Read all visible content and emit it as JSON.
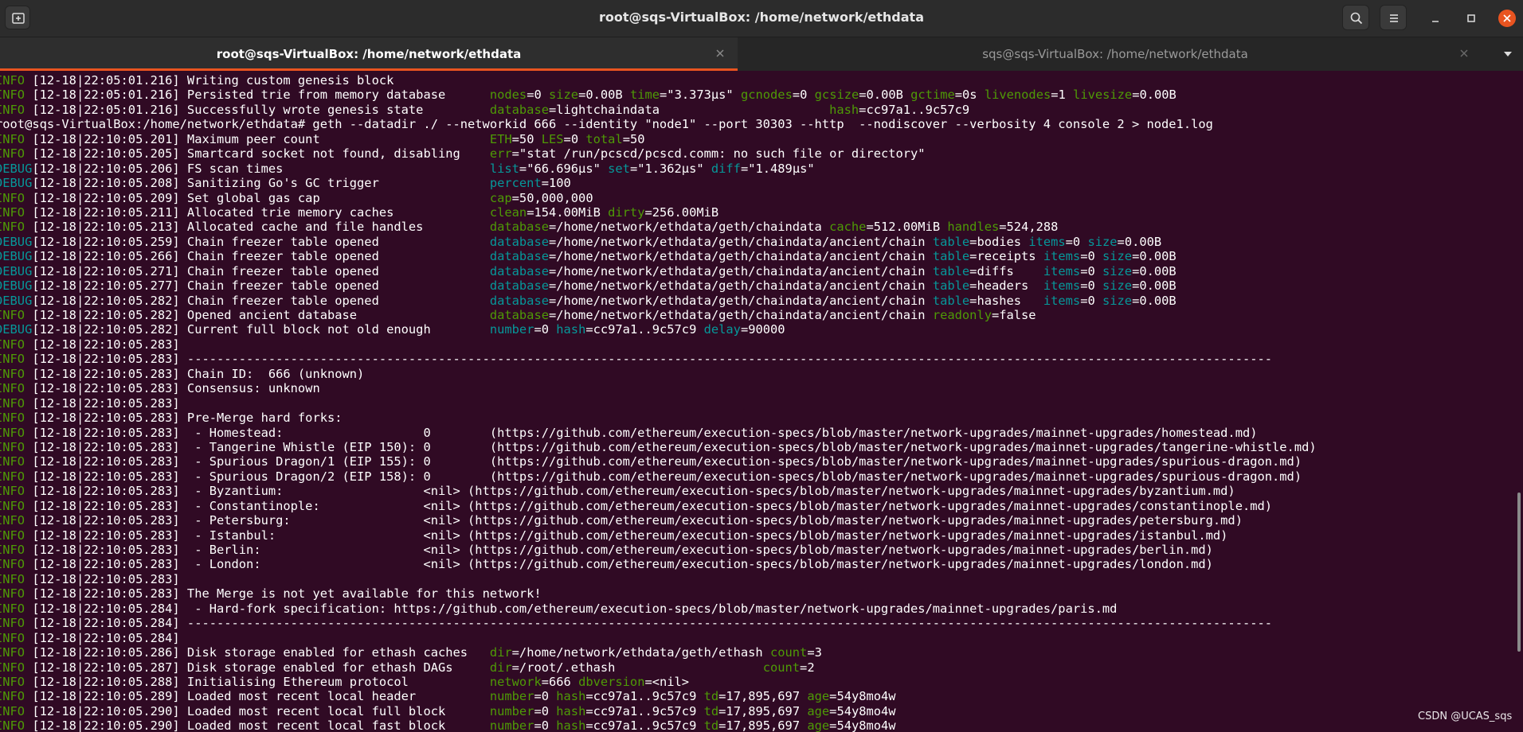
{
  "window": {
    "title": "root@sqs-VirtualBox: /home/network/ethdata"
  },
  "tabs": [
    {
      "label": "root@sqs-VirtualBox: /home/network/ethdata",
      "active": true
    },
    {
      "label": "sqs@sqs-VirtualBox: /home/network/ethdata",
      "active": false
    }
  ],
  "icons": {
    "new_tab": "new-tab-icon",
    "search": "search-icon",
    "menu": "hamburger-menu-icon",
    "minimize": "minimize-icon",
    "maximize": "maximize-icon",
    "close": "close-icon",
    "tab_close": "tab-close-icon",
    "tab_list": "chevron-down-icon"
  },
  "colors": {
    "terminal_bg": "#300a24",
    "accent": "#e95420",
    "info": "#4e9a06",
    "debug": "#06989a"
  },
  "terminal": {
    "lines": [
      [
        {
          "t": "INFO ",
          "c": "info"
        },
        {
          "t": "[12-18|22:05:01.216] Writing custom genesis block"
        }
      ],
      [
        {
          "t": "INFO ",
          "c": "info"
        },
        {
          "t": "[12-18|22:05:01.216] Persisted trie from memory database      "
        },
        {
          "t": "nodes",
          "c": "key"
        },
        {
          "t": "=0 "
        },
        {
          "t": "size",
          "c": "key"
        },
        {
          "t": "=0.00B "
        },
        {
          "t": "time",
          "c": "key"
        },
        {
          "t": "=\"3.373µs\" "
        },
        {
          "t": "gcnodes",
          "c": "key"
        },
        {
          "t": "=0 "
        },
        {
          "t": "gcsize",
          "c": "key"
        },
        {
          "t": "=0.00B "
        },
        {
          "t": "gctime",
          "c": "key"
        },
        {
          "t": "=0s "
        },
        {
          "t": "livenodes",
          "c": "key"
        },
        {
          "t": "=1 "
        },
        {
          "t": "livesize",
          "c": "key"
        },
        {
          "t": "=0.00B"
        }
      ],
      [
        {
          "t": "INFO ",
          "c": "info"
        },
        {
          "t": "[12-18|22:05:01.216] Successfully wrote genesis state         "
        },
        {
          "t": "database",
          "c": "key"
        },
        {
          "t": "=lightchaindata                       "
        },
        {
          "t": "hash",
          "c": "key"
        },
        {
          "t": "=cc97a1..9c57c9"
        }
      ],
      [
        {
          "t": "root@sqs-VirtualBox:/home/network/ethdata# geth --datadir ./ --networkid 666 --identity \"node1\" --port 30303 --http  --nodiscover --verbosity 4 console 2 > node1.log"
        }
      ],
      [
        {
          "t": "INFO ",
          "c": "info"
        },
        {
          "t": "[12-18|22:10:05.201] Maximum peer count                       "
        },
        {
          "t": "ETH",
          "c": "key"
        },
        {
          "t": "=50 "
        },
        {
          "t": "LES",
          "c": "key"
        },
        {
          "t": "=0 "
        },
        {
          "t": "total",
          "c": "key"
        },
        {
          "t": "=50"
        }
      ],
      [
        {
          "t": "INFO ",
          "c": "info"
        },
        {
          "t": "[12-18|22:10:05.205] Smartcard socket not found, disabling    "
        },
        {
          "t": "err",
          "c": "key"
        },
        {
          "t": "=\"stat /run/pcscd/pcscd.comm: no such file or directory\""
        }
      ],
      [
        {
          "t": "DEBUG",
          "c": "debug"
        },
        {
          "t": "[12-18|22:10:05.206] FS scan times                            "
        },
        {
          "t": "list",
          "c": "key2"
        },
        {
          "t": "=\"66.696µs\" "
        },
        {
          "t": "set",
          "c": "key2"
        },
        {
          "t": "=\"1.362µs\" "
        },
        {
          "t": "diff",
          "c": "key2"
        },
        {
          "t": "=\"1.489µs\""
        }
      ],
      [
        {
          "t": "DEBUG",
          "c": "debug"
        },
        {
          "t": "[12-18|22:10:05.208] Sanitizing Go's GC trigger               "
        },
        {
          "t": "percent",
          "c": "key2"
        },
        {
          "t": "=100"
        }
      ],
      [
        {
          "t": "INFO ",
          "c": "info"
        },
        {
          "t": "[12-18|22:10:05.209] Set global gas cap                       "
        },
        {
          "t": "cap",
          "c": "key"
        },
        {
          "t": "=50,000,000"
        }
      ],
      [
        {
          "t": "INFO ",
          "c": "info"
        },
        {
          "t": "[12-18|22:10:05.211] Allocated trie memory caches             "
        },
        {
          "t": "clean",
          "c": "key"
        },
        {
          "t": "=154.00MiB "
        },
        {
          "t": "dirty",
          "c": "key"
        },
        {
          "t": "=256.00MiB"
        }
      ],
      [
        {
          "t": "INFO ",
          "c": "info"
        },
        {
          "t": "[12-18|22:10:05.213] Allocated cache and file handles         "
        },
        {
          "t": "database",
          "c": "key"
        },
        {
          "t": "=/home/network/ethdata/geth/chaindata "
        },
        {
          "t": "cache",
          "c": "key"
        },
        {
          "t": "=512.00MiB "
        },
        {
          "t": "handles",
          "c": "key"
        },
        {
          "t": "=524,288"
        }
      ],
      [
        {
          "t": "DEBUG",
          "c": "debug"
        },
        {
          "t": "[12-18|22:10:05.259] Chain freezer table opened               "
        },
        {
          "t": "database",
          "c": "key2"
        },
        {
          "t": "=/home/network/ethdata/geth/chaindata/ancient/chain "
        },
        {
          "t": "table",
          "c": "key2"
        },
        {
          "t": "=bodies "
        },
        {
          "t": "items",
          "c": "key2"
        },
        {
          "t": "=0 "
        },
        {
          "t": "size",
          "c": "key2"
        },
        {
          "t": "=0.00B"
        }
      ],
      [
        {
          "t": "DEBUG",
          "c": "debug"
        },
        {
          "t": "[12-18|22:10:05.266] Chain freezer table opened               "
        },
        {
          "t": "database",
          "c": "key2"
        },
        {
          "t": "=/home/network/ethdata/geth/chaindata/ancient/chain "
        },
        {
          "t": "table",
          "c": "key2"
        },
        {
          "t": "=receipts "
        },
        {
          "t": "items",
          "c": "key2"
        },
        {
          "t": "=0 "
        },
        {
          "t": "size",
          "c": "key2"
        },
        {
          "t": "=0.00B"
        }
      ],
      [
        {
          "t": "DEBUG",
          "c": "debug"
        },
        {
          "t": "[12-18|22:10:05.271] Chain freezer table opened               "
        },
        {
          "t": "database",
          "c": "key2"
        },
        {
          "t": "=/home/network/ethdata/geth/chaindata/ancient/chain "
        },
        {
          "t": "table",
          "c": "key2"
        },
        {
          "t": "=diffs    "
        },
        {
          "t": "items",
          "c": "key2"
        },
        {
          "t": "=0 "
        },
        {
          "t": "size",
          "c": "key2"
        },
        {
          "t": "=0.00B"
        }
      ],
      [
        {
          "t": "DEBUG",
          "c": "debug"
        },
        {
          "t": "[12-18|22:10:05.277] Chain freezer table opened               "
        },
        {
          "t": "database",
          "c": "key2"
        },
        {
          "t": "=/home/network/ethdata/geth/chaindata/ancient/chain "
        },
        {
          "t": "table",
          "c": "key2"
        },
        {
          "t": "=headers  "
        },
        {
          "t": "items",
          "c": "key2"
        },
        {
          "t": "=0 "
        },
        {
          "t": "size",
          "c": "key2"
        },
        {
          "t": "=0.00B"
        }
      ],
      [
        {
          "t": "DEBUG",
          "c": "debug"
        },
        {
          "t": "[12-18|22:10:05.282] Chain freezer table opened               "
        },
        {
          "t": "database",
          "c": "key2"
        },
        {
          "t": "=/home/network/ethdata/geth/chaindata/ancient/chain "
        },
        {
          "t": "table",
          "c": "key2"
        },
        {
          "t": "=hashes   "
        },
        {
          "t": "items",
          "c": "key2"
        },
        {
          "t": "=0 "
        },
        {
          "t": "size",
          "c": "key2"
        },
        {
          "t": "=0.00B"
        }
      ],
      [
        {
          "t": "INFO ",
          "c": "info"
        },
        {
          "t": "[12-18|22:10:05.282] Opened ancient database                  "
        },
        {
          "t": "database",
          "c": "key"
        },
        {
          "t": "=/home/network/ethdata/geth/chaindata/ancient/chain "
        },
        {
          "t": "readonly",
          "c": "key"
        },
        {
          "t": "=false"
        }
      ],
      [
        {
          "t": "DEBUG",
          "c": "debug"
        },
        {
          "t": "[12-18|22:10:05.282] Current full block not old enough        "
        },
        {
          "t": "number",
          "c": "key2"
        },
        {
          "t": "=0 "
        },
        {
          "t": "hash",
          "c": "key2"
        },
        {
          "t": "=cc97a1..9c57c9 "
        },
        {
          "t": "delay",
          "c": "key2"
        },
        {
          "t": "=90000"
        }
      ],
      [
        {
          "t": "INFO ",
          "c": "info"
        },
        {
          "t": "[12-18|22:10:05.283]"
        }
      ],
      [
        {
          "t": "INFO ",
          "c": "info"
        },
        {
          "t": "[12-18|22:10:05.283] ---------------------------------------------------------------------------------------------------------------------------------------------------"
        }
      ],
      [
        {
          "t": "INFO ",
          "c": "info"
        },
        {
          "t": "[12-18|22:10:05.283] Chain ID:  666 (unknown)"
        }
      ],
      [
        {
          "t": "INFO ",
          "c": "info"
        },
        {
          "t": "[12-18|22:10:05.283] Consensus: unknown"
        }
      ],
      [
        {
          "t": "INFO ",
          "c": "info"
        },
        {
          "t": "[12-18|22:10:05.283]"
        }
      ],
      [
        {
          "t": "INFO ",
          "c": "info"
        },
        {
          "t": "[12-18|22:10:05.283] Pre-Merge hard forks:"
        }
      ],
      [
        {
          "t": "INFO ",
          "c": "info"
        },
        {
          "t": "[12-18|22:10:05.283]  - Homestead:                   0        (https://github.com/ethereum/execution-specs/blob/master/network-upgrades/mainnet-upgrades/homestead.md)"
        }
      ],
      [
        {
          "t": "INFO ",
          "c": "info"
        },
        {
          "t": "[12-18|22:10:05.283]  - Tangerine Whistle (EIP 150): 0        (https://github.com/ethereum/execution-specs/blob/master/network-upgrades/mainnet-upgrades/tangerine-whistle.md)"
        }
      ],
      [
        {
          "t": "INFO ",
          "c": "info"
        },
        {
          "t": "[12-18|22:10:05.283]  - Spurious Dragon/1 (EIP 155): 0        (https://github.com/ethereum/execution-specs/blob/master/network-upgrades/mainnet-upgrades/spurious-dragon.md)"
        }
      ],
      [
        {
          "t": "INFO ",
          "c": "info"
        },
        {
          "t": "[12-18|22:10:05.283]  - Spurious Dragon/2 (EIP 158): 0        (https://github.com/ethereum/execution-specs/blob/master/network-upgrades/mainnet-upgrades/spurious-dragon.md)"
        }
      ],
      [
        {
          "t": "INFO ",
          "c": "info"
        },
        {
          "t": "[12-18|22:10:05.283]  - Byzantium:                   <nil> (https://github.com/ethereum/execution-specs/blob/master/network-upgrades/mainnet-upgrades/byzantium.md)"
        }
      ],
      [
        {
          "t": "INFO ",
          "c": "info"
        },
        {
          "t": "[12-18|22:10:05.283]  - Constantinople:              <nil> (https://github.com/ethereum/execution-specs/blob/master/network-upgrades/mainnet-upgrades/constantinople.md)"
        }
      ],
      [
        {
          "t": "INFO ",
          "c": "info"
        },
        {
          "t": "[12-18|22:10:05.283]  - Petersburg:                  <nil> (https://github.com/ethereum/execution-specs/blob/master/network-upgrades/mainnet-upgrades/petersburg.md)"
        }
      ],
      [
        {
          "t": "INFO ",
          "c": "info"
        },
        {
          "t": "[12-18|22:10:05.283]  - Istanbul:                    <nil> (https://github.com/ethereum/execution-specs/blob/master/network-upgrades/mainnet-upgrades/istanbul.md)"
        }
      ],
      [
        {
          "t": "INFO ",
          "c": "info"
        },
        {
          "t": "[12-18|22:10:05.283]  - Berlin:                      <nil> (https://github.com/ethereum/execution-specs/blob/master/network-upgrades/mainnet-upgrades/berlin.md)"
        }
      ],
      [
        {
          "t": "INFO ",
          "c": "info"
        },
        {
          "t": "[12-18|22:10:05.283]  - London:                      <nil> (https://github.com/ethereum/execution-specs/blob/master/network-upgrades/mainnet-upgrades/london.md)"
        }
      ],
      [
        {
          "t": "INFO ",
          "c": "info"
        },
        {
          "t": "[12-18|22:10:05.283]"
        }
      ],
      [
        {
          "t": "INFO ",
          "c": "info"
        },
        {
          "t": "[12-18|22:10:05.283] The Merge is not yet available for this network!"
        }
      ],
      [
        {
          "t": "INFO ",
          "c": "info"
        },
        {
          "t": "[12-18|22:10:05.284]  - Hard-fork specification: https://github.com/ethereum/execution-specs/blob/master/network-upgrades/mainnet-upgrades/paris.md"
        }
      ],
      [
        {
          "t": "INFO ",
          "c": "info"
        },
        {
          "t": "[12-18|22:10:05.284] ---------------------------------------------------------------------------------------------------------------------------------------------------"
        }
      ],
      [
        {
          "t": "INFO ",
          "c": "info"
        },
        {
          "t": "[12-18|22:10:05.284]"
        }
      ],
      [
        {
          "t": "INFO ",
          "c": "info"
        },
        {
          "t": "[12-18|22:10:05.286] Disk storage enabled for ethash caches   "
        },
        {
          "t": "dir",
          "c": "key"
        },
        {
          "t": "=/home/network/ethdata/geth/ethash "
        },
        {
          "t": "count",
          "c": "key"
        },
        {
          "t": "=3"
        }
      ],
      [
        {
          "t": "INFO ",
          "c": "info"
        },
        {
          "t": "[12-18|22:10:05.287] Disk storage enabled for ethash DAGs     "
        },
        {
          "t": "dir",
          "c": "key"
        },
        {
          "t": "=/root/.ethash                    "
        },
        {
          "t": "count",
          "c": "key"
        },
        {
          "t": "=2"
        }
      ],
      [
        {
          "t": "INFO ",
          "c": "info"
        },
        {
          "t": "[12-18|22:10:05.288] Initialising Ethereum protocol           "
        },
        {
          "t": "network",
          "c": "key"
        },
        {
          "t": "=666 "
        },
        {
          "t": "dbversion",
          "c": "key"
        },
        {
          "t": "=<nil>"
        }
      ],
      [
        {
          "t": "INFO ",
          "c": "info"
        },
        {
          "t": "[12-18|22:10:05.289] Loaded most recent local header          "
        },
        {
          "t": "number",
          "c": "key"
        },
        {
          "t": "=0 "
        },
        {
          "t": "hash",
          "c": "key"
        },
        {
          "t": "=cc97a1..9c57c9 "
        },
        {
          "t": "td",
          "c": "key"
        },
        {
          "t": "=17,895,697 "
        },
        {
          "t": "age",
          "c": "key"
        },
        {
          "t": "=54y8mo4w"
        }
      ],
      [
        {
          "t": "INFO ",
          "c": "info"
        },
        {
          "t": "[12-18|22:10:05.290] Loaded most recent local full block      "
        },
        {
          "t": "number",
          "c": "key"
        },
        {
          "t": "=0 "
        },
        {
          "t": "hash",
          "c": "key"
        },
        {
          "t": "=cc97a1..9c57c9 "
        },
        {
          "t": "td",
          "c": "key"
        },
        {
          "t": "=17,895,697 "
        },
        {
          "t": "age",
          "c": "key"
        },
        {
          "t": "=54y8mo4w"
        }
      ],
      [
        {
          "t": "INFO ",
          "c": "info"
        },
        {
          "t": "[12-18|22:10:05.290] Loaded most recent local fast block      "
        },
        {
          "t": "number",
          "c": "key"
        },
        {
          "t": "=0 "
        },
        {
          "t": "hash",
          "c": "key"
        },
        {
          "t": "=cc97a1..9c57c9 "
        },
        {
          "t": "td",
          "c": "key"
        },
        {
          "t": "=17,895,697 "
        },
        {
          "t": "age",
          "c": "key"
        },
        {
          "t": "=54y8mo4w"
        }
      ]
    ]
  },
  "watermark": "CSDN @UCAS_sqs"
}
